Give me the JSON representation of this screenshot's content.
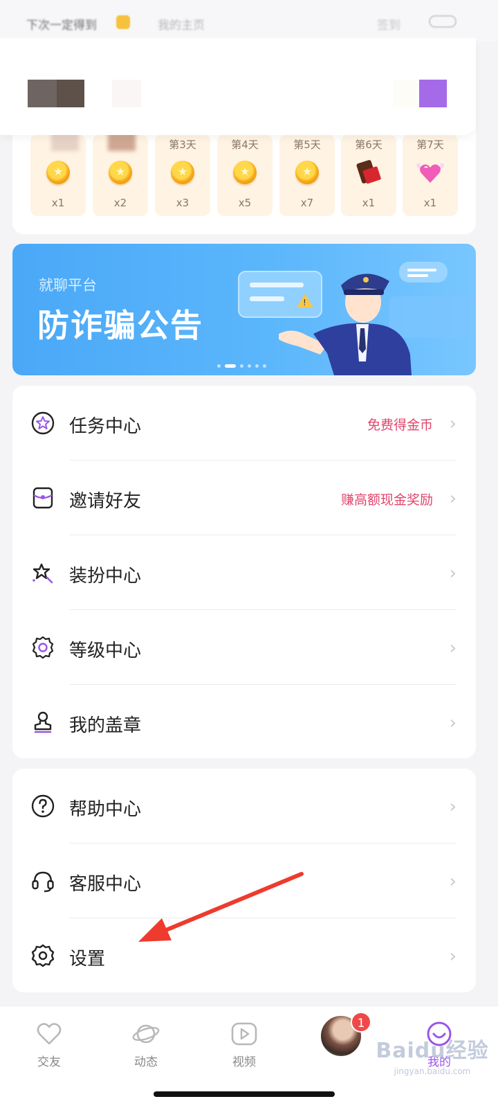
{
  "profile": {
    "blurred_text_1": "下次一定得到",
    "blurred_text_2": "我的主页",
    "blurred_text_3": "签到"
  },
  "signin": {
    "days": [
      {
        "label": "",
        "reward": "x1",
        "item": "coin"
      },
      {
        "label": "",
        "reward": "x2",
        "item": "coin"
      },
      {
        "label": "第3天",
        "reward": "x3",
        "item": "coin"
      },
      {
        "label": "第4天",
        "reward": "x5",
        "item": "coin"
      },
      {
        "label": "第5天",
        "reward": "x7",
        "item": "coin"
      },
      {
        "label": "第6天",
        "reward": "x1",
        "item": "chocolate"
      },
      {
        "label": "第7天",
        "reward": "x1",
        "item": "heart"
      }
    ]
  },
  "banner": {
    "subtitle": "就聊平台",
    "title": "防诈骗公告",
    "colors": {
      "start": "#4aa8f7",
      "end": "#78c6ff"
    }
  },
  "menu_group_1": [
    {
      "label": "任务中心",
      "hint": "免费得金币",
      "icon": "star-badge-icon"
    },
    {
      "label": "邀请好友",
      "hint": "赚高额现金奖励",
      "icon": "envelope-icon"
    },
    {
      "label": "装扮中心",
      "hint": "",
      "icon": "magic-star-icon"
    },
    {
      "label": "等级中心",
      "hint": "",
      "icon": "medal-icon"
    },
    {
      "label": "我的盖章",
      "hint": "",
      "icon": "stamp-icon"
    }
  ],
  "menu_group_2": [
    {
      "label": "帮助中心",
      "icon": "help-circle-icon"
    },
    {
      "label": "客服中心",
      "icon": "headset-icon"
    },
    {
      "label": "设置",
      "icon": "gear-icon"
    }
  ],
  "tabbar": {
    "items": [
      {
        "label": "交友",
        "icon": "heart-icon"
      },
      {
        "label": "动态",
        "icon": "planet-icon"
      },
      {
        "label": "视频",
        "icon": "play-icon"
      },
      {
        "label": "",
        "icon": "avatar"
      },
      {
        "label": "我的",
        "icon": "smile-icon"
      }
    ],
    "badge_count": "1",
    "active_color": "#9b55e8"
  },
  "watermark": {
    "line1": "Baidu经验",
    "line2": "jingyan.baidu.com"
  },
  "colors": {
    "accent": "#9b55e8",
    "hint": "#e1456b",
    "arrow": "#ee3b2e"
  }
}
